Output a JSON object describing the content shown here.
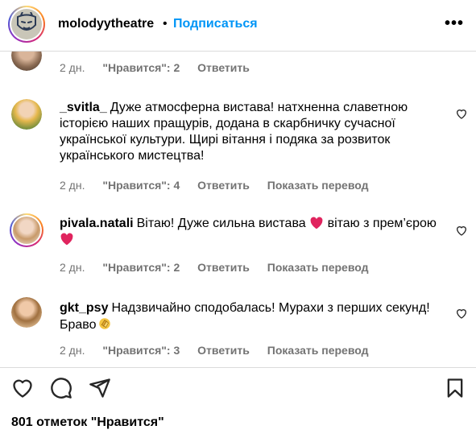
{
  "header": {
    "username": "molodyytheatre",
    "separator": "•",
    "follow_label": "Подписаться",
    "more_label": "•••"
  },
  "comments": [
    {
      "time": "2 дн.",
      "likes": "\"Нравится\": 2",
      "reply": "Ответить"
    },
    {
      "user": "_svitla_",
      "text": "Дуже атмосферна вистава! натхненна славетною історією наших пращурів, додана в скарбничку сучасної української культури. Щирі вітання і подяка за розвиток українського мистецтва!",
      "time": "2 дн.",
      "likes": "\"Нравится\": 4",
      "reply": "Ответить",
      "translate": "Показать перевод"
    },
    {
      "user": "pivala.natali",
      "text_a": "Вітаю! Дуже сильна вистава",
      "text_b": "вітаю з прем’єрою",
      "time": "2 дн.",
      "likes": "\"Нравится\": 2",
      "reply": "Ответить",
      "translate": "Показать перевод"
    },
    {
      "user": "gkt_psy",
      "text": "Надзвичайно сподобалась! Мурахи з перших секунд! Браво",
      "time": "2 дн.",
      "likes": "\"Нравится\": 3",
      "reply": "Ответить",
      "translate": "Показать перевод"
    }
  ],
  "footer": {
    "likes_count": "801 отметок \"Нравится\""
  },
  "icons": {
    "like": "heart-outline-icon",
    "comment": "comment-bubble-icon",
    "share": "paper-plane-icon",
    "save": "bookmark-icon",
    "comment_like": "small-heart-icon",
    "emoji_heart": "red-heart-emoji",
    "emoji_clap": "clapping-hands-emoji"
  },
  "colors": {
    "accent": "#0095f6",
    "secondary_text": "#737373",
    "divider": "#dbdbdb",
    "emoji_red": "#e0245e"
  }
}
